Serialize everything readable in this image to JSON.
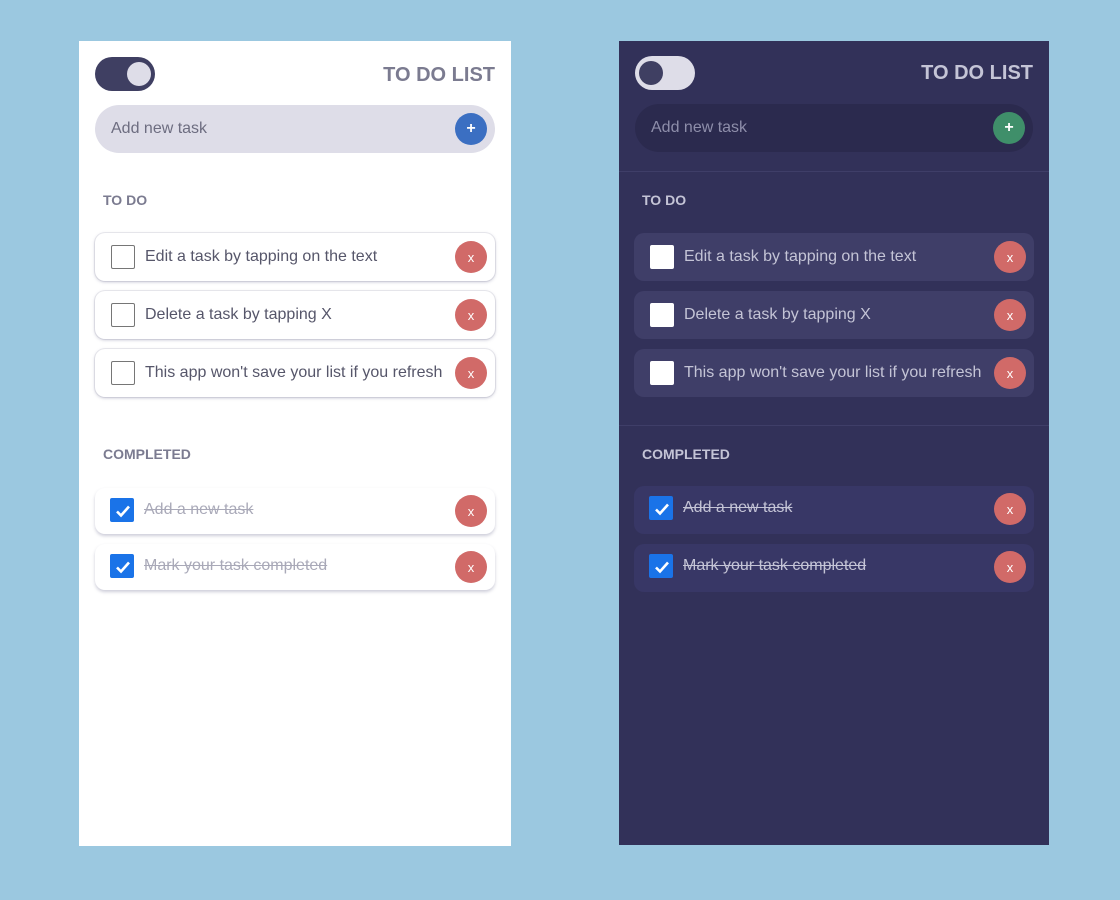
{
  "light_panel": {
    "theme": "light",
    "title": "TO DO LIST",
    "add_placeholder": "Add new task",
    "add_button": "+",
    "todo_label": "TO DO",
    "completed_label": "COMPLETED",
    "todo_items": [
      {
        "text": "Edit a task by tapping on the text",
        "delete": "x"
      },
      {
        "text": "Delete a task by tapping X",
        "delete": "x"
      },
      {
        "text": "This app won't save your list if you refresh",
        "delete": "x"
      }
    ],
    "completed_items": [
      {
        "text": "Add a new task",
        "delete": "x"
      },
      {
        "text": "Mark your task completed",
        "delete": "x"
      }
    ]
  },
  "dark_panel": {
    "theme": "dark",
    "title": "TO DO LIST",
    "add_placeholder": "Add new task",
    "add_button": "+",
    "todo_label": "TO DO",
    "completed_label": "COMPLETED",
    "todo_items": [
      {
        "text": "Edit a task by tapping on the text",
        "delete": "x"
      },
      {
        "text": "Delete a task by tapping X",
        "delete": "x"
      },
      {
        "text": "This app won't save your list if you refresh",
        "delete": "x"
      }
    ],
    "completed_items": [
      {
        "text": "Add a new task",
        "delete": "x"
      },
      {
        "text": "Mark your task completed",
        "delete": "x"
      }
    ]
  },
  "colors": {
    "background": "#9bc8e0",
    "light_panel_bg": "#ffffff",
    "dark_panel_bg": "#323159",
    "add_button_light": "#3b6fc2",
    "add_button_dark": "#3f8f6a",
    "delete_button": "#d16a68",
    "checkbox_checked": "#1a73e8"
  }
}
